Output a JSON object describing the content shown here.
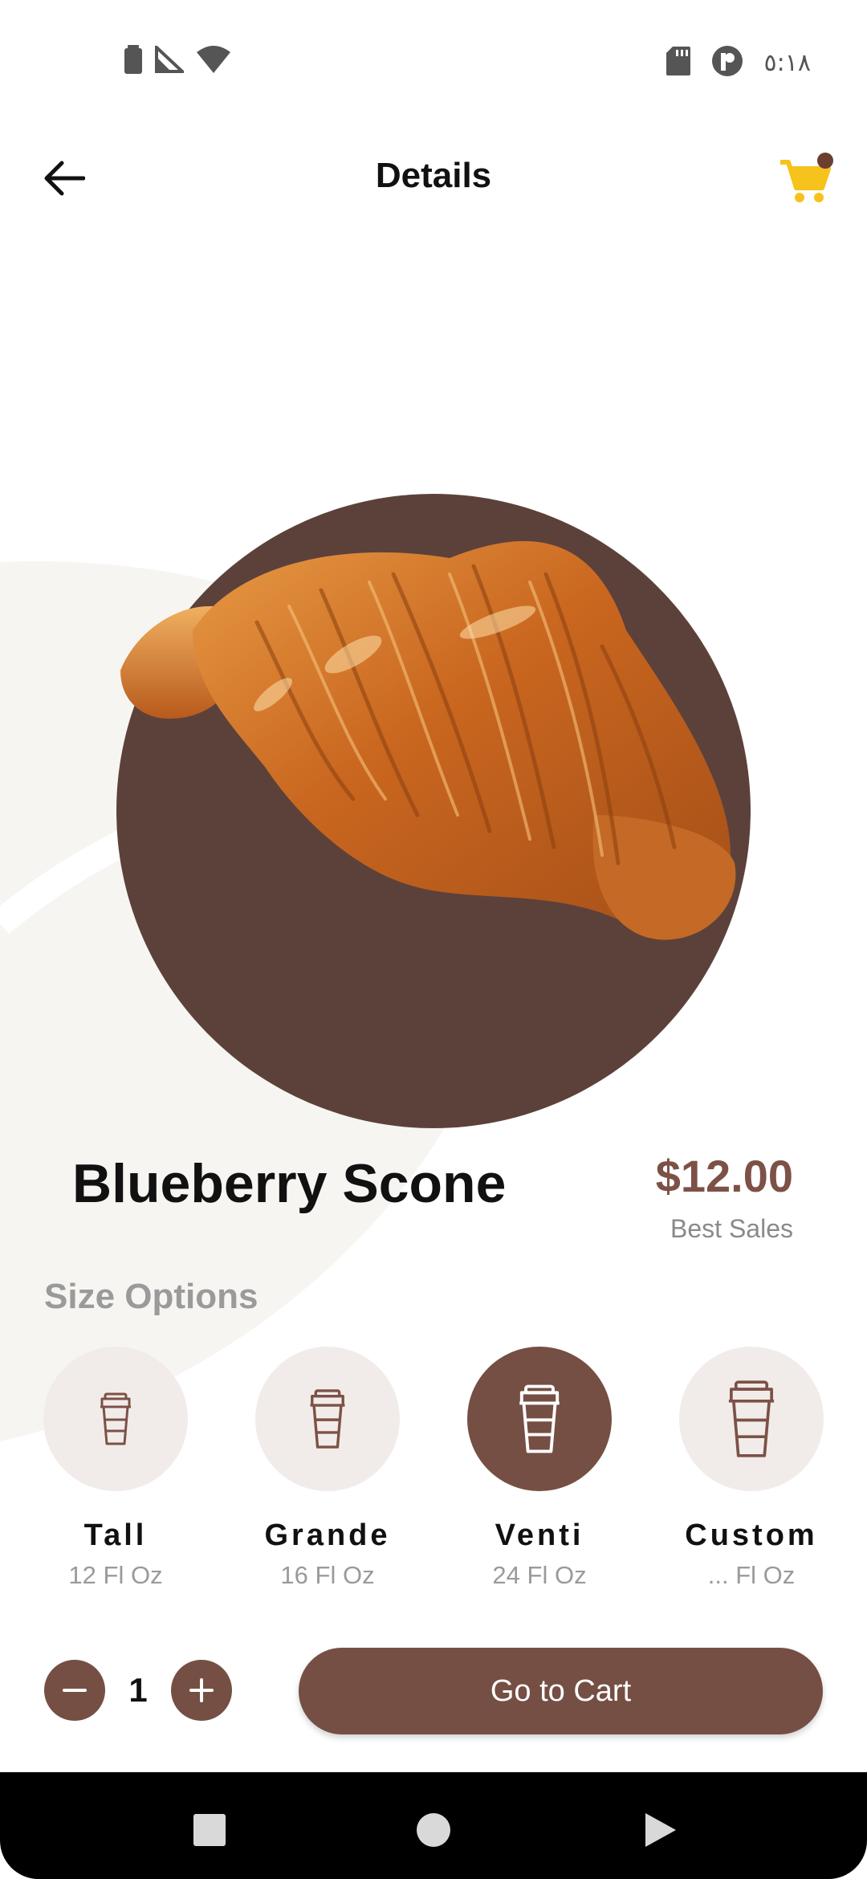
{
  "status_bar": {
    "time": "٥:١٨",
    "left_icons": [
      "battery-icon",
      "signal-icon",
      "wifi-icon"
    ],
    "right_icons": [
      "sd-card-icon",
      "app-notification-icon"
    ]
  },
  "app_bar": {
    "title": "Details",
    "back_icon": "arrow-left-icon",
    "cart_icon": "shopping-cart-icon",
    "cart_badge_color": "#6b3f2f",
    "cart_color": "#f6c21c"
  },
  "product": {
    "name": "Blueberry Scone",
    "price": "$12.00",
    "price_sub": "Best Sales",
    "image": "croissant-image",
    "circle_color": "#5c413b"
  },
  "size_options": {
    "title": "Size Options",
    "selected_index": 2,
    "items": [
      {
        "name": "Tall",
        "sub": "12 Fl Oz"
      },
      {
        "name": "Grande",
        "sub": "16 Fl Oz"
      },
      {
        "name": "Venti",
        "sub": "24 Fl Oz"
      },
      {
        "name": "Custom",
        "sub": "... Fl Oz"
      }
    ]
  },
  "quantity": {
    "value": "1",
    "minus_icon": "minus-icon",
    "plus_icon": "plus-icon"
  },
  "cta": {
    "label": "Go to Cart"
  },
  "nav_bar": {
    "items": [
      "recents-square-icon",
      "home-circle-icon",
      "back-triangle-icon"
    ]
  },
  "colors": {
    "accent": "#754f44",
    "price": "#7d5146",
    "muted": "#9a9a9a",
    "size_bg": "#f1ecea"
  }
}
